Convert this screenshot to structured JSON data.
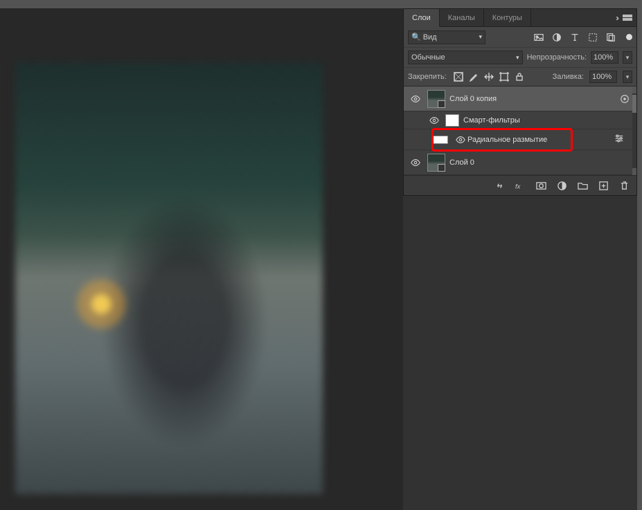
{
  "panel": {
    "tabs": {
      "layers": "Слои",
      "channels": "Каналы",
      "paths": "Контуры"
    },
    "search_label": "Вид",
    "blend_mode": "Обычные",
    "opacity_label": "Непрозрачность:",
    "opacity_value": "100%",
    "lock_label": "Закрепить:",
    "fill_label": "Заливка:",
    "fill_value": "100%"
  },
  "layers": {
    "layer0copy": "Слой 0 копия",
    "smart_filters": "Смарт-фильтры",
    "radial_blur": "Радиальное размытие",
    "layer0": "Слой 0"
  },
  "icons": {
    "image": "image-filter-icon",
    "adjust": "adjust-icon",
    "type": "type-icon",
    "shape": "shape-icon",
    "smart": "smart-icon"
  }
}
